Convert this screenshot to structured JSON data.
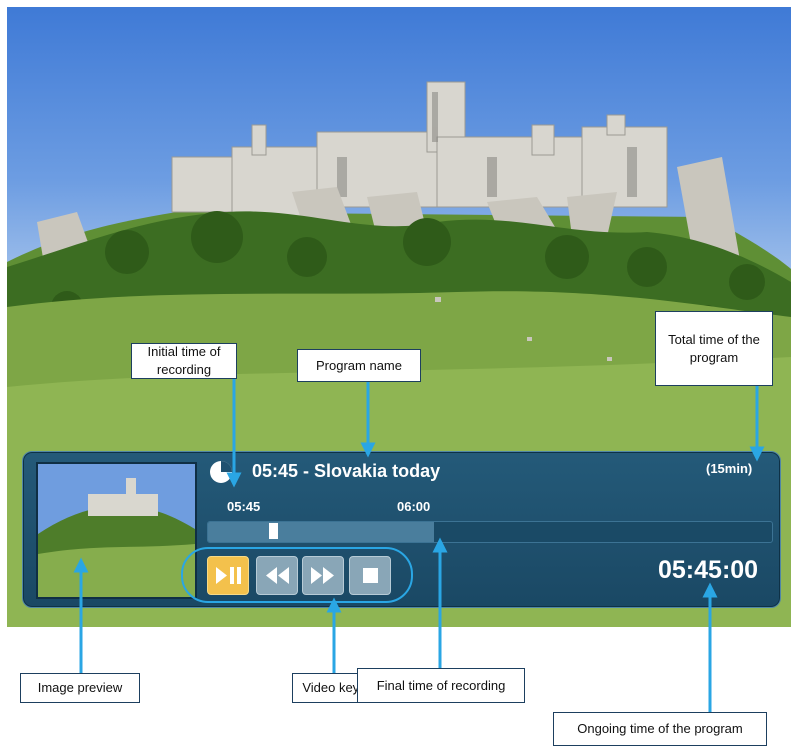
{
  "player": {
    "program_title": "05:45 - Slovakia today",
    "duration": "(15min)",
    "start_time": "05:45",
    "end_time": "06:00",
    "ongoing_time": "05:45:00",
    "recorded_fraction": 0.4,
    "position_fraction": 0.11,
    "keys": [
      {
        "name": "play-pause",
        "icon": "play-pause-icon",
        "active": true
      },
      {
        "name": "rewind",
        "icon": "rewind-icon",
        "active": false
      },
      {
        "name": "fast-forward",
        "icon": "fast-forward-icon",
        "active": false
      },
      {
        "name": "stop",
        "icon": "stop-icon",
        "active": false
      }
    ]
  },
  "callouts": {
    "initial_time": "Initial time of recording",
    "program_name": "Program name",
    "total_time": "Total time of the program",
    "image_preview": "Image preview",
    "video_keys": "Video keys",
    "final_time": "Final time of recording",
    "ongoing_time": "Ongoing time of the program"
  },
  "colors": {
    "accent": "#2aa6e4",
    "panel": "#1f5170",
    "play_key": "#f3c14c",
    "key": "#89a6b7"
  }
}
